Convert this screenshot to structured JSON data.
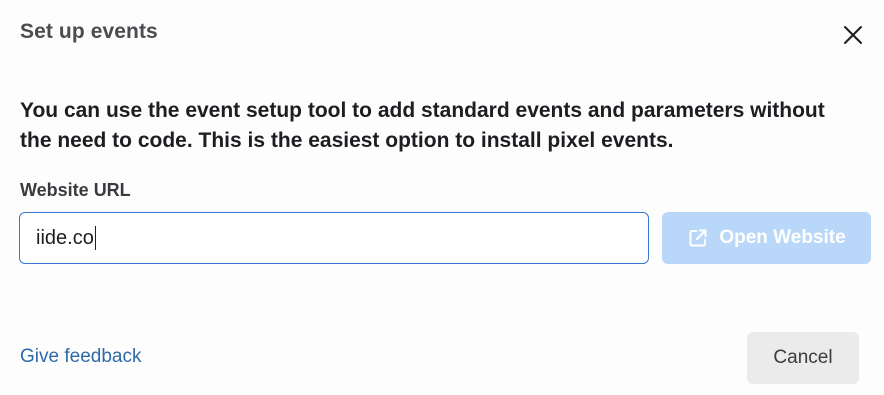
{
  "dialog": {
    "title": "Set up events",
    "description": "You can use the event setup tool to add standard events and parameters without the need to code. This is the easiest option to install pixel events.",
    "url_label": "Website URL",
    "url_value": "iide.co",
    "open_button_label": "Open Website",
    "open_button_icon": "external-link-icon",
    "close_icon": "close-icon",
    "feedback_link": "Give feedback",
    "cancel_label": "Cancel"
  },
  "colors": {
    "accent": "#3b78d0",
    "disabled_button": "#b9d8f9",
    "link": "#2d6aa8",
    "secondary_button": "#ebebeb"
  }
}
